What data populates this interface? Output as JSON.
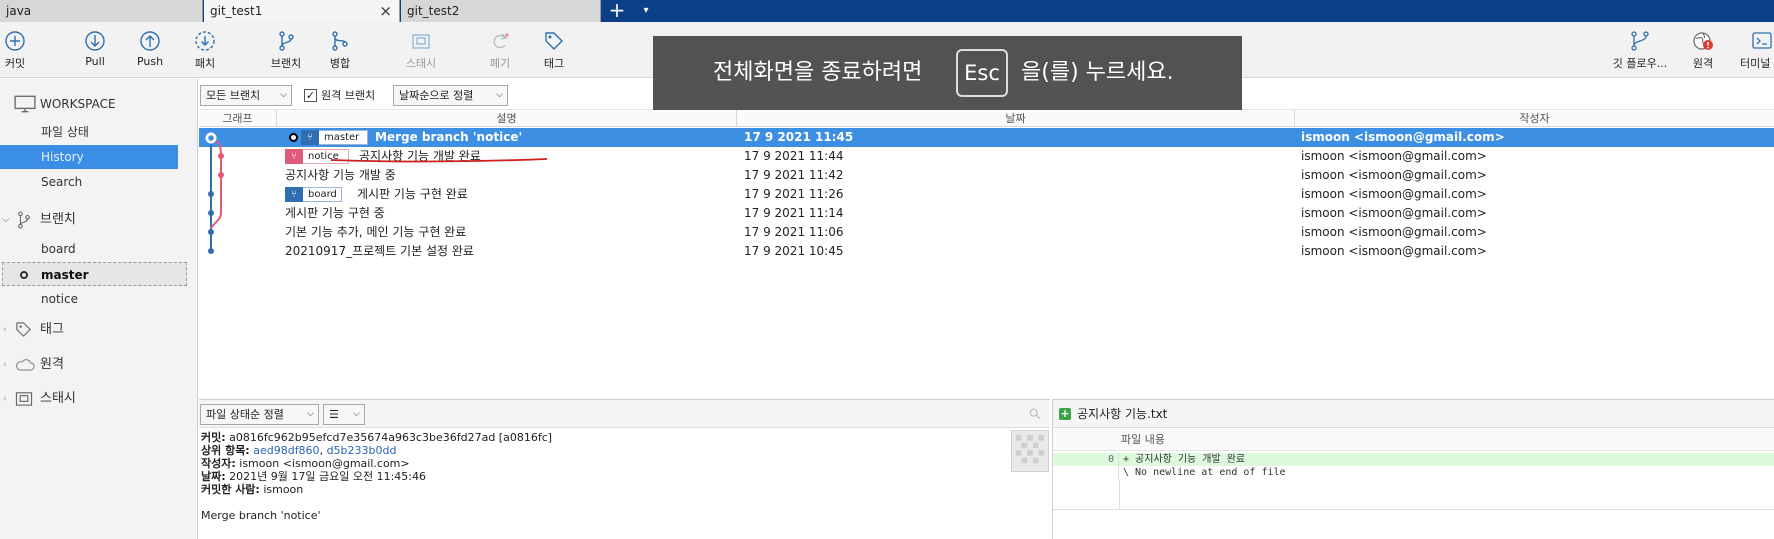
{
  "tabs": [
    {
      "label": "java"
    },
    {
      "label": "git_test1",
      "close": "×"
    },
    {
      "label": "git_test2"
    }
  ],
  "tabbar": {
    "add": "+",
    "menu": "▾"
  },
  "toolbar": {
    "commit": "커밋",
    "pull": "Pull",
    "push": "Push",
    "fetch": "패치",
    "branch": "브랜치",
    "merge": "병합",
    "stash": "스태시",
    "discard": "폐기",
    "tag": "태그",
    "git_flow": "깃 플로우...",
    "remote": "원격",
    "terminal": "터미널"
  },
  "esc_overlay": {
    "before": "전체화면을 종료하려면",
    "key": "Esc",
    "after": "을(를) 누르세요."
  },
  "sidebar": {
    "workspace": "WORKSPACE",
    "file_status": "파일 상태",
    "history": "History",
    "search": "Search",
    "branches_header": "브랜치",
    "branches": [
      "board",
      "master",
      "notice"
    ],
    "tags_header": "태그",
    "remotes_header": "원격",
    "stashes_header": "스태시"
  },
  "list_toolbar": {
    "branch_filter": "모든 브랜치",
    "show_remote": "원격 브랜치",
    "show_remote_checked": "✓",
    "sort": "날짜순으로 정렬"
  },
  "columns": {
    "graph": "그래프",
    "description": "설명",
    "date": "날짜",
    "author": "작성자"
  },
  "commits": [
    {
      "description": "Merge branch 'notice'",
      "date": "17 9 2021 11:45",
      "author": "ismoon <ismoon@gmail.com>",
      "badge": "master"
    },
    {
      "description": "공지사항 기능 개발 완료",
      "date": "17 9 2021 11:44",
      "author": "ismoon <ismoon@gmail.com>",
      "badge": "notice"
    },
    {
      "description": "공지사항 기능 개발 중",
      "date": "17 9 2021 11:42",
      "author": "ismoon <ismoon@gmail.com>"
    },
    {
      "description": "게시판 기능 구현 완료",
      "date": "17 9 2021 11:26",
      "author": "ismoon <ismoon@gmail.com>",
      "badge": "board"
    },
    {
      "description": "게시판 기능 구현 중",
      "date": "17 9 2021 11:14",
      "author": "ismoon <ismoon@gmail.com>"
    },
    {
      "description": "기본 기능 추가, 메인 기능 구현 완료",
      "date": "17 9 2021 11:06",
      "author": "ismoon <ismoon@gmail.com>"
    },
    {
      "description": "20210917_프로젝트 기본 설정 완료",
      "date": "17 9 2021 10:45",
      "author": "ismoon <ismoon@gmail.com>"
    }
  ],
  "file_pane": {
    "sort": "파일 상태순 정렬",
    "view": "☰"
  },
  "commit_detail": {
    "commit_label": "커밋:",
    "commit_value": "a0816fc962b95efcd7e35674a963c3be36fd27ad [a0816fc]",
    "parents_label": "상위 항목:",
    "parent1": "aed98df860",
    "parent_sep": ",",
    "parent2": "d5b233b0dd",
    "author_label": "작성자:",
    "author_value": "ismoon <ismoon@gmail.com>",
    "date_label": "날짜:",
    "date_value": "2021년 9월 17일 금요일 오전 11:45:46",
    "committer_label": "커밋한 사람:",
    "committer_value": "ismoon",
    "message": "Merge branch 'notice'"
  },
  "diff": {
    "file": "공지사항 기능.txt",
    "header": "파일 내용",
    "lines": [
      {
        "no": "0",
        "text": "+ 공지사항 기능 개발 완료"
      },
      {
        "no": "",
        "text": "\\ No newline at end of file"
      }
    ]
  },
  "colors": {
    "selection": "#3d8fe3",
    "tabbar": "#0b3f88",
    "branch_blue": "#2f6fb0",
    "branch_pink": "#e05a7a",
    "annotation": "#cc1f1f"
  }
}
